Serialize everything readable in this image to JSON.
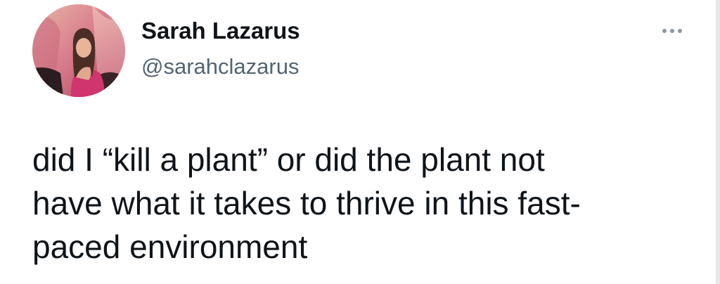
{
  "author": {
    "name": "Sarah Lazarus",
    "handle": "@sarahclazarus",
    "avatar_icon": "profile-photo"
  },
  "more_icon": "more-horizontal-icon",
  "tweet": {
    "lines": [
      "did I “kill a plant” or did the plant not",
      "have what it takes to thrive in this fast-",
      "paced environment"
    ]
  },
  "colors": {
    "name": "#0f1419",
    "handle": "#536471",
    "icon": "#8b98a5",
    "background": "#ffffff"
  }
}
